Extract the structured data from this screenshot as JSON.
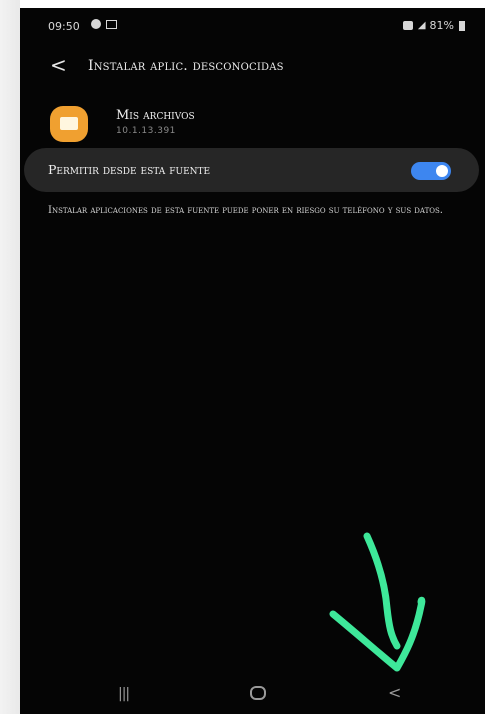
{
  "status_bar": {
    "time": "09:50",
    "battery": "81%",
    "signal_glyph": "◢"
  },
  "header": {
    "back_icon": "chevron-left-icon",
    "back_glyph": "<",
    "title": "Instalar aplic. desconocidas"
  },
  "app": {
    "name": "Mis archivos",
    "version": "10.1.13.391",
    "icon": "folder-icon",
    "icon_color": "#f0a030"
  },
  "setting": {
    "label": "Permitir desde esta fuente",
    "enabled": true,
    "toggle_color": "#3d86f0"
  },
  "warning": {
    "text": "Instalar aplicaciones de esta fuente puede poner en riesgo su teléfono y sus datos."
  },
  "annotation": {
    "icon": "hand-drawn-arrow-icon",
    "color": "#3ee89a"
  },
  "nav_bar": {
    "recents_glyph": "|||",
    "recents_icon": "recents-icon",
    "home_icon": "home-icon",
    "back_glyph": "<",
    "back_icon": "back-icon"
  }
}
